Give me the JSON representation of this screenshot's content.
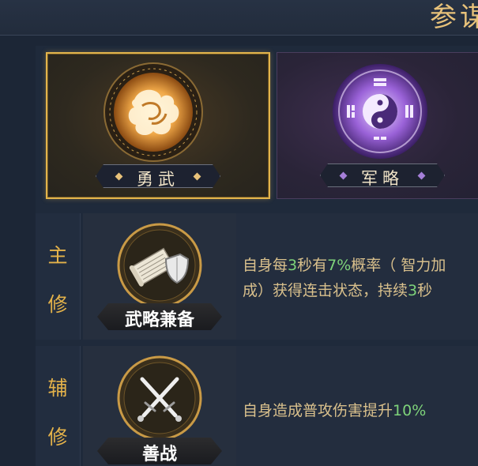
{
  "header": {
    "title": "参谋"
  },
  "cards": [
    {
      "label": "勇武",
      "selected": true,
      "accent": "#e2b44c"
    },
    {
      "label": "军略",
      "selected": false,
      "accent": "#a57fd8"
    }
  ],
  "main_skill": {
    "label_1": "主",
    "label_2": "修",
    "icon": "scroll-shield-icon",
    "name": "武略兼备",
    "desc": {
      "line1_a": "自身每",
      "line1_n1": "3",
      "line1_b": "秒有",
      "line1_n2": "7%",
      "line1_c": "概率（ 智力加",
      "line2_a": "成）获得连击状态，持续",
      "line2_n": "3",
      "line2_b": "秒"
    }
  },
  "sub_skill": {
    "label_1": "辅",
    "label_2": "修",
    "icon": "crossed-swords-icon",
    "name": "善战",
    "desc": {
      "text": "自身造成普攻伤害提升",
      "num": "10%"
    }
  },
  "colors": {
    "highlight": "#7ed37a",
    "gold": "#e4b24a",
    "desc_text": "#d9c08c"
  }
}
